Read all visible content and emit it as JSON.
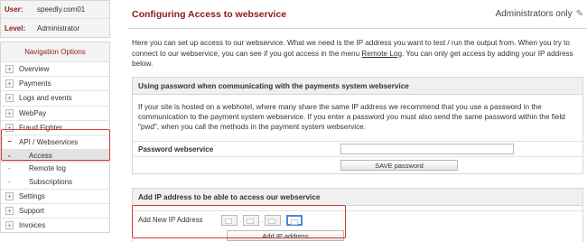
{
  "user": {
    "user_label": "User:",
    "user_value": "speedly.com01",
    "level_label": "Level:",
    "level_value": "Administrator"
  },
  "nav": {
    "heading": "Navigation Options",
    "items": [
      {
        "label": "Overview",
        "marker": "+"
      },
      {
        "label": "Payments",
        "marker": "+"
      },
      {
        "label": "Logs and events",
        "marker": "+"
      },
      {
        "label": "WebPay",
        "marker": "+"
      },
      {
        "label": "Fraud Fighter",
        "marker": "+"
      },
      {
        "label": "API / Webservices",
        "marker": "−"
      }
    ],
    "subitems": [
      {
        "label": "Access",
        "marker": "-"
      },
      {
        "label": "Remote log",
        "marker": "-"
      },
      {
        "label": "Subscriptions",
        "marker": "-"
      }
    ],
    "items_after": [
      {
        "label": "Settings",
        "marker": "+"
      },
      {
        "label": "Support",
        "marker": "+"
      },
      {
        "label": "Invoices",
        "marker": "+"
      }
    ]
  },
  "header": {
    "title": "Configuring Access to webservice",
    "admin_text": "Administrators only",
    "edit_icon": "pencil-icon"
  },
  "intro": {
    "text_before": "Here you can set up access to our webservice. What we need is the IP address you want to test / run the output from. When you try to connect to our webservice, you can see if you got access in the menu ",
    "link": "Remote Log",
    "text_after": ". You can only get access by adding your IP address below."
  },
  "password_panel": {
    "heading": "Using password when communicating with the payments system webservice",
    "body": "If your site is hosted on a webhotel, where many share the same IP address we recommend that you use a password in the communication to the payment system webservice. If you enter a password you must also send the same password within the field \"pwd\", when you call the methods in the payment system webservice.",
    "field_label": "Password webservice",
    "field_value": "",
    "save_button": "SAVE password"
  },
  "ip_panel": {
    "heading": "Add IP address to be able to access our webservice",
    "field_label": "Add New IP Address",
    "octets": [
      "",
      "",
      "",
      ""
    ],
    "dot": ".",
    "add_button": "Add IP address"
  },
  "colors": {
    "accent": "#8b1a1a",
    "highlight": "#d23a3a",
    "focus": "#4a87d9"
  }
}
